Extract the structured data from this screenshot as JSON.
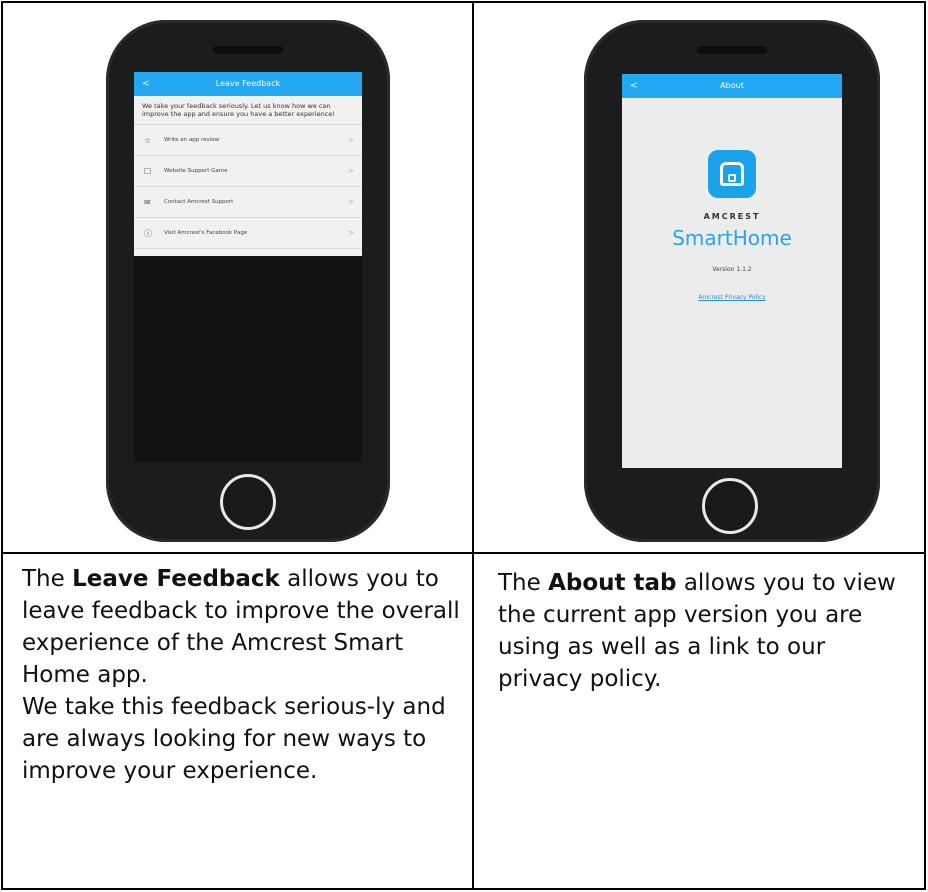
{
  "left": {
    "screen": {
      "title": "Leave Feedback",
      "back": "<",
      "intro": "We take your feedback seriously. Let us know how we can improve the app and ensure you have a better experience!",
      "items": [
        {
          "icon": "☆",
          "icon_name": "star-icon",
          "label": "Write an app review",
          "chev": ">"
        },
        {
          "icon": "☐",
          "icon_name": "document-icon",
          "label": "Website Support Game",
          "chev": ">"
        },
        {
          "icon": "✉",
          "icon_name": "mail-icon",
          "label": "Contact Amcrest Support",
          "chev": ">"
        },
        {
          "icon": "ⓘ",
          "icon_name": "info-icon",
          "label": "Visit Amcrest's Facebook Page",
          "chev": ">"
        }
      ]
    },
    "caption": {
      "pre": "The ",
      "bold": "Leave Feedback",
      "post": " allows you to leave feedback to improve the overall experience of the Amcrest Smart Home app.",
      "second": "We take this feedback serious-ly and are always looking for new ways to improve your experience."
    }
  },
  "right": {
    "screen": {
      "title": "About",
      "back": "<",
      "brand": "AMCREST",
      "product": "SmartHome",
      "version": "Version 1.1.2",
      "privacy": "Amcrest Privacy Policy"
    },
    "caption": {
      "pre": "The ",
      "bold": "About tab",
      "post": " allows you to view the current app version you are using as well as a link to our privacy policy."
    }
  },
  "colors": {
    "accent": "#22a7f0",
    "phone": "#1c1c1c",
    "logo": "#1aa3ea"
  }
}
